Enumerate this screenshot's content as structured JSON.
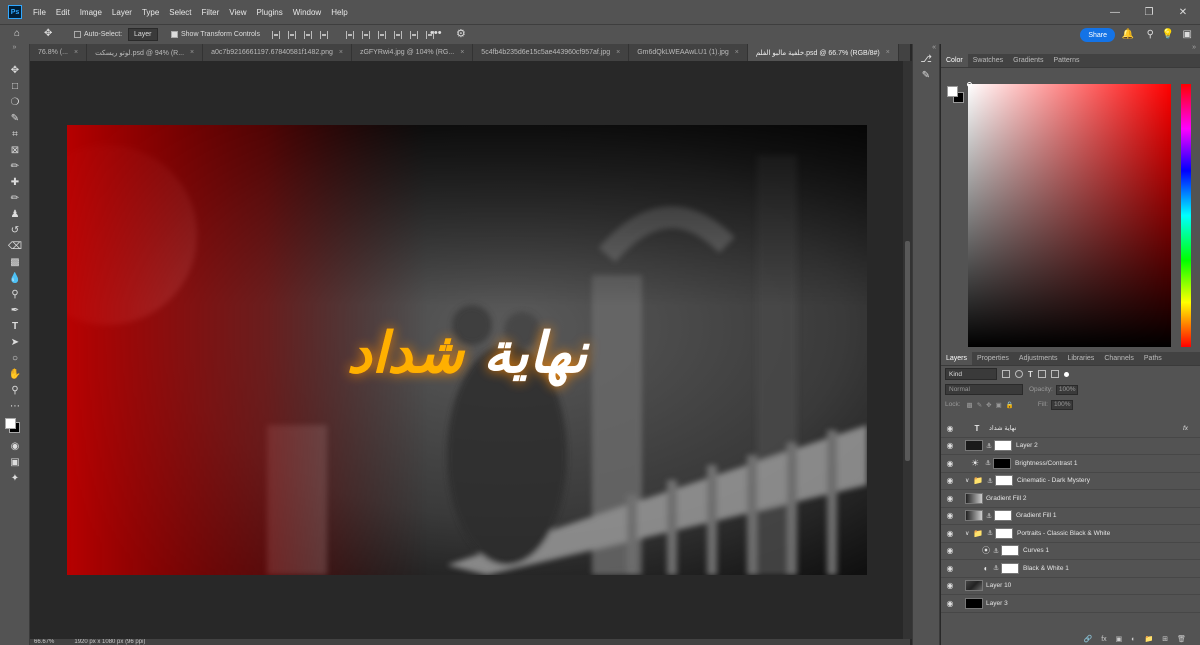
{
  "menu": [
    "File",
    "Edit",
    "Image",
    "Layer",
    "Type",
    "Select",
    "Filter",
    "View",
    "Plugins",
    "Window",
    "Help"
  ],
  "options": {
    "auto_select": "Auto-Select:",
    "layer_select": "Layer",
    "show_transform": "Show Transform Controls",
    "share": "Share"
  },
  "tabs": [
    {
      "label": "76.8% (...",
      "active": false
    },
    {
      "label": "لوتو ريسكت.psd @ 94% (R...",
      "active": false
    },
    {
      "label": "a0c7b9216661197.67840581f1482.png",
      "active": false
    },
    {
      "label": "zGFYRwi4.jpg @ 104% (RG...",
      "active": false
    },
    {
      "label": "5c4fb4b235d6e15c5ae443960cf957af.jpg",
      "active": false
    },
    {
      "label": "Gm6dQkLWEAAwLU1 (1).jpg",
      "active": false
    },
    {
      "label": "خلفية مالبو الفلم.psd @ 66.7% (RGB/8#)",
      "active": true
    }
  ],
  "canvas": {
    "title_text": "نهاية شداد"
  },
  "status": {
    "zoom": "66.67%",
    "size": "1920 px x 1080 px (96 ppi)"
  },
  "color_panel": {
    "tabs": [
      "Color",
      "Swatches",
      "Gradients",
      "Patterns"
    ]
  },
  "layers_panel": {
    "tabs": [
      "Layers",
      "Properties",
      "Adjustments",
      "Libraries",
      "Channels",
      "Paths"
    ],
    "kind": "Kind",
    "blend_mode": "Normal",
    "opacity_label": "Opacity:",
    "opacity_value": "100%",
    "lock_label": "Lock:",
    "fill_label": "Fill:",
    "fill_value": "100%",
    "layers": [
      {
        "name": "نهاية شداد",
        "type": "text",
        "indent": 0,
        "fx": true
      },
      {
        "name": "Layer 2",
        "type": "masked",
        "indent": 0,
        "thumb": "#1a1a1a"
      },
      {
        "name": "Brightness/Contrast 1",
        "type": "adjust",
        "indent": 0
      },
      {
        "name": "Cinematic - Dark Mystery",
        "type": "group",
        "indent": 0
      },
      {
        "name": "Gradient Fill 2",
        "type": "gradient",
        "indent": 0
      },
      {
        "name": "Gradient Fill 1",
        "type": "gradient-masked",
        "indent": 0
      },
      {
        "name": "Portraits - Classic Black & White",
        "type": "group",
        "indent": 0
      },
      {
        "name": "Curves 1",
        "type": "curves",
        "indent": 1
      },
      {
        "name": "Black & White 1",
        "type": "bw",
        "indent": 1
      },
      {
        "name": "Layer 10",
        "type": "photo",
        "indent": 0
      },
      {
        "name": "Layer 3",
        "type": "black",
        "indent": 0
      }
    ]
  }
}
